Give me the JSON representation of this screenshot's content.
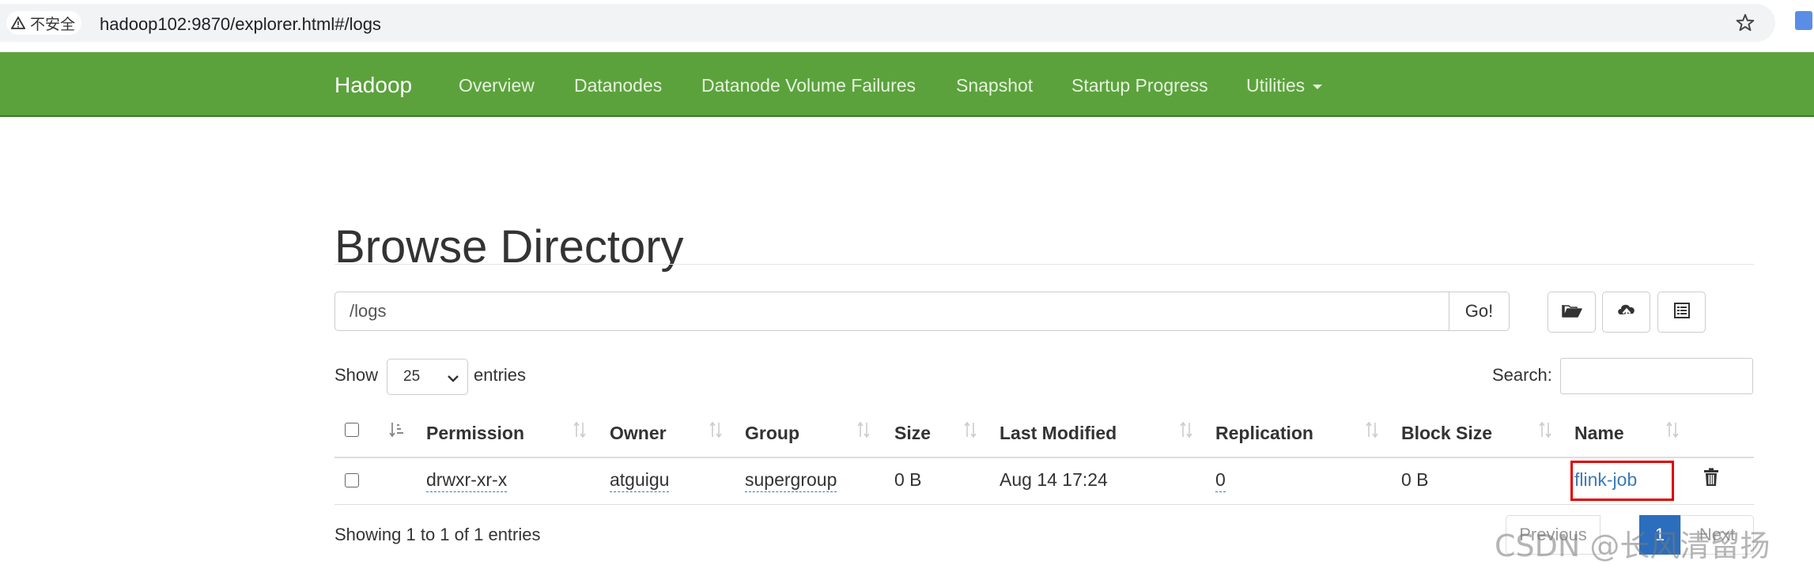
{
  "browser": {
    "security_label": "不安全",
    "url": "hadoop102:9870/explorer.html#/logs"
  },
  "navbar": {
    "brand": "Hadoop",
    "items": [
      "Overview",
      "Datanodes",
      "Datanode Volume Failures",
      "Snapshot",
      "Startup Progress",
      "Utilities"
    ]
  },
  "page": {
    "title": "Browse Directory"
  },
  "path_bar": {
    "value": "/logs",
    "go_label": "Go!"
  },
  "controls": {
    "show_label": "Show",
    "entries_value": "25",
    "entries_label": "entries",
    "search_label": "Search:"
  },
  "table": {
    "headers": [
      "Permission",
      "Owner",
      "Group",
      "Size",
      "Last Modified",
      "Replication",
      "Block Size",
      "Name"
    ],
    "rows": [
      {
        "permission": "drwxr-xr-x",
        "owner": "atguigu",
        "group": "supergroup",
        "size": "0 B",
        "last_modified": "Aug 14 17:24",
        "replication": "0",
        "block_size": "0 B",
        "name": "flink-job"
      }
    ]
  },
  "footer": {
    "showing": "Showing 1 to 1 of 1 entries",
    "prev_label": "Previous",
    "current_page": "1",
    "next_label": "Next"
  },
  "watermark": "CSDN @长风清留扬",
  "colors": {
    "navbar": "#5ba23c",
    "link": "#3a7ab8",
    "highlight": "#e00000",
    "pager_active": "#2a6ebd"
  }
}
